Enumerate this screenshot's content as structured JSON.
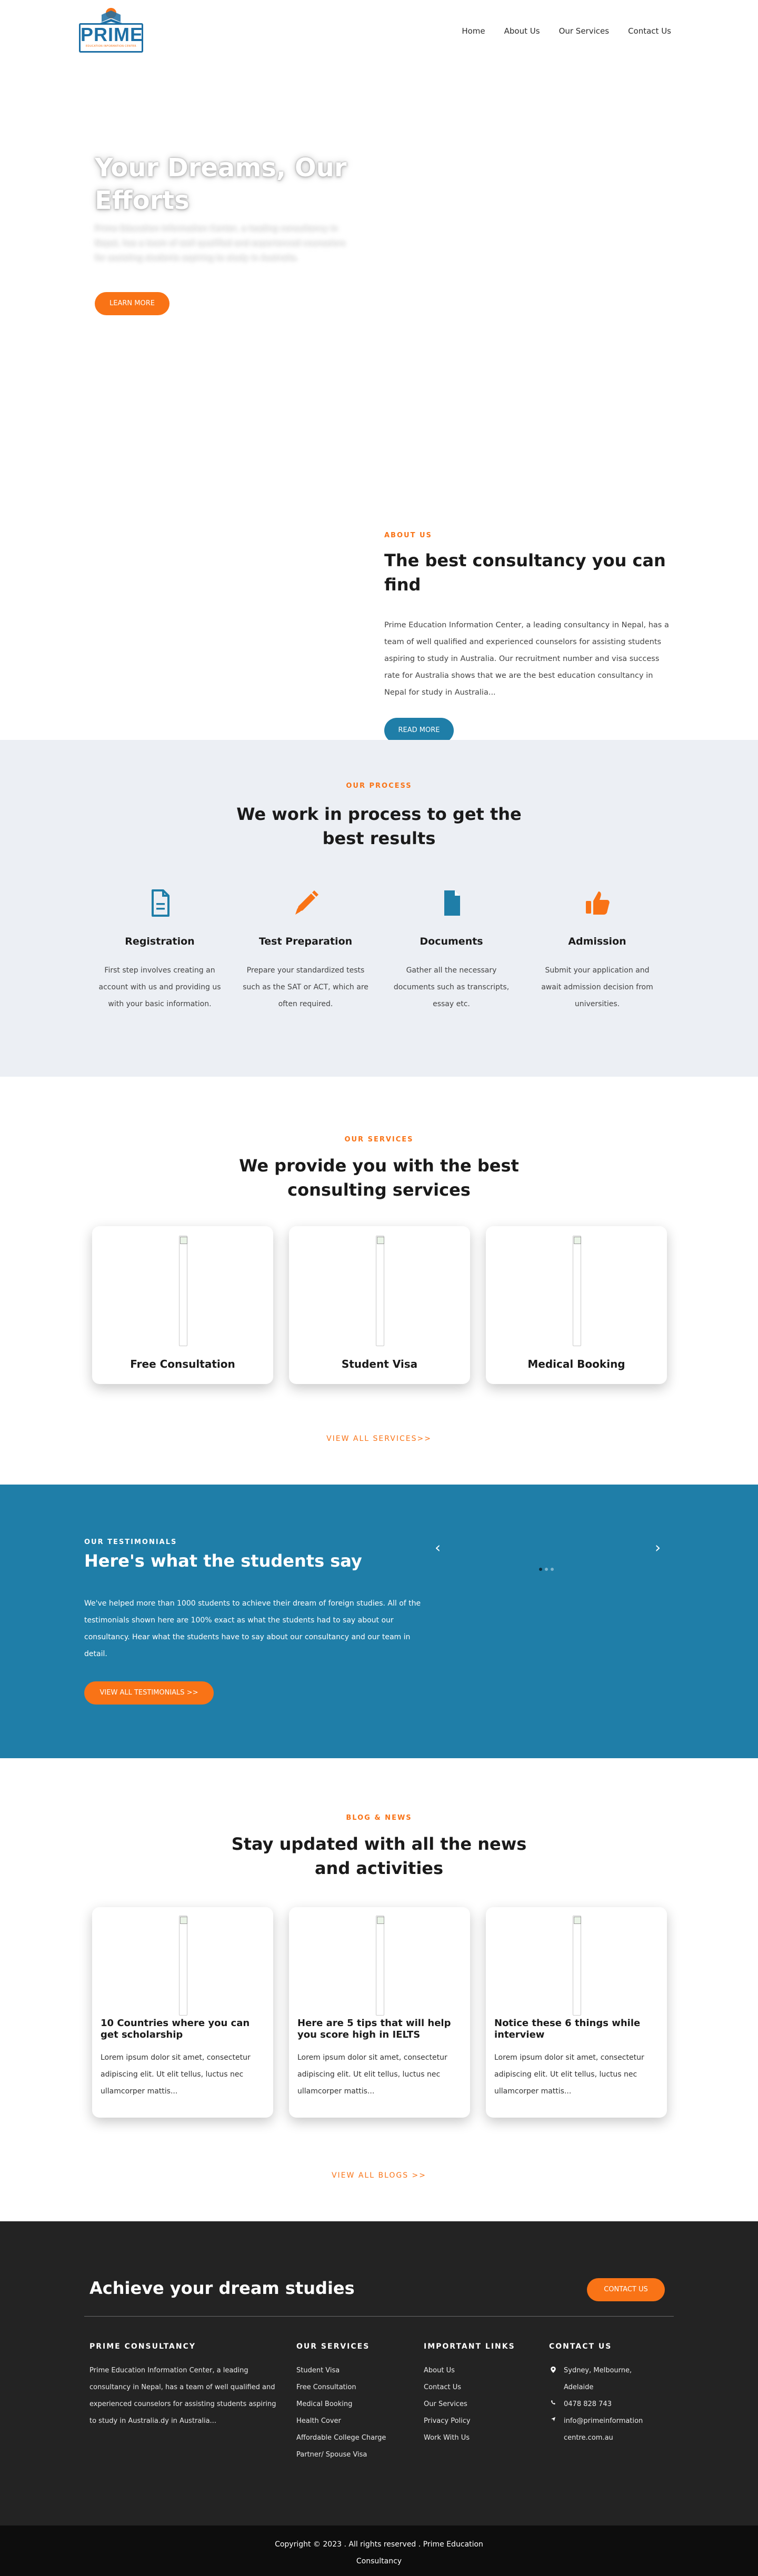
{
  "nav": {
    "logo_text": "PRIME",
    "logo_subtext": "EDUCATION INFORMATION CENTER",
    "items": [
      "Home",
      "About Us",
      "Our Services",
      "Contact Us"
    ]
  },
  "hero": {
    "title": "Your Dreams, Our Efforts",
    "text": "Prime Education Information Center, a leading consultancy in Nepal, has a team of well qualified and experienced counselors for assisting students aspiring to study in Australia.",
    "button": "LEARN MORE"
  },
  "about": {
    "eyebrow": "ABOUT US",
    "title": "The best consultancy you can find",
    "text": "Prime Education Information Center, a leading consultancy in Nepal, has a team of well qualified and experienced counselors for assisting students aspiring to study in Australia. Our recruitment number and visa success rate for Australia shows that we are the best education consultancy in Nepal for study in Australia...",
    "button": "READ MORE"
  },
  "process": {
    "eyebrow": "OUR PROCESS",
    "title": "We work in process to get the best results",
    "steps": [
      {
        "icon": "document-icon",
        "title": "Registration",
        "text": "First step involves creating an account with us and providing us with your basic information."
      },
      {
        "icon": "pencil-icon",
        "title": "Test Preparation",
        "text": "Prepare your standardized tests such as the SAT or ACT, which are often required."
      },
      {
        "icon": "file-icon",
        "title": "Documents",
        "text": "Gather all the necessary documents such as transcripts, essay etc."
      },
      {
        "icon": "thumbs-up-icon",
        "title": "Admission",
        "text": "Submit your application and await admission decision from universities."
      }
    ]
  },
  "services": {
    "eyebrow": "OUR SERVICES",
    "title": "We provide you with the best consulting services",
    "cards": [
      "Free Consultation",
      "Student Visa",
      "Medical Booking"
    ],
    "view_all": "VIEW ALL SERVICES>>"
  },
  "testimonials": {
    "eyebrow": "OUR TESTIMONIALS",
    "title": "Here's what the students say",
    "text": "We've helped more than 1000 students to achieve their dream of foreign studies. All of the testimonials shown here are 100% exact as what the students had to say about our consultancy. Hear what the students have to say about our consultancy and our team in detail.",
    "button": "VIEW ALL TESTIMONIALS >>"
  },
  "blog": {
    "eyebrow": "BLOG & NEWS",
    "title": "Stay updated with all the news and activities",
    "posts": [
      {
        "title": "10 Countries where you can get scholarship",
        "excerpt": "Lorem ipsum dolor sit amet, consectetur adipiscing elit. Ut elit tellus, luctus nec ullamcorper mattis..."
      },
      {
        "title": "Here are 5 tips that will help you score high in IELTS",
        "excerpt": "Lorem ipsum dolor sit amet, consectetur adipiscing elit. Ut elit tellus, luctus nec ullamcorper mattis..."
      },
      {
        "title": "Notice these 6 things while interview",
        "excerpt": "Lorem ipsum dolor sit amet, consectetur adipiscing elit. Ut elit tellus, luctus nec ullamcorper mattis..."
      }
    ],
    "view_all": "VIEW ALL BLOGS >>"
  },
  "footer": {
    "cta_title": "Achieve your dream studies",
    "cta_button": "CONTACT US",
    "about_heading": "PRIME CONSULTANCY",
    "about_text": "Prime Education Information Center, a leading consultancy in Nepal, has a team of well qualified and experienced counselors for assisting students aspiring to study in Australia.dy in Australia...",
    "services_heading": "OUR SERVICES",
    "services": [
      "Student Visa",
      "Free Consultation",
      "Medical Booking",
      "Health Cover",
      "Affordable College Charge",
      "Partner/ Spouse Visa"
    ],
    "links_heading": "IMPORTANT LINKS",
    "links": [
      "About Us",
      "Contact Us",
      "Our Services",
      "Privacy Policy",
      "Work With Us"
    ],
    "contact_heading": "CONTACT US",
    "address": "Sydney, Melbourne, Adelaide",
    "phone": "0478 828 743",
    "email": "info@primeinformation centre.com.au",
    "copyright": "Copyright © 2023 . All rights reserved . Prime Education Consultancy"
  },
  "colors": {
    "accent": "#f97316",
    "brand_blue": "#1f7ea8",
    "footer_bg": "#232323"
  }
}
